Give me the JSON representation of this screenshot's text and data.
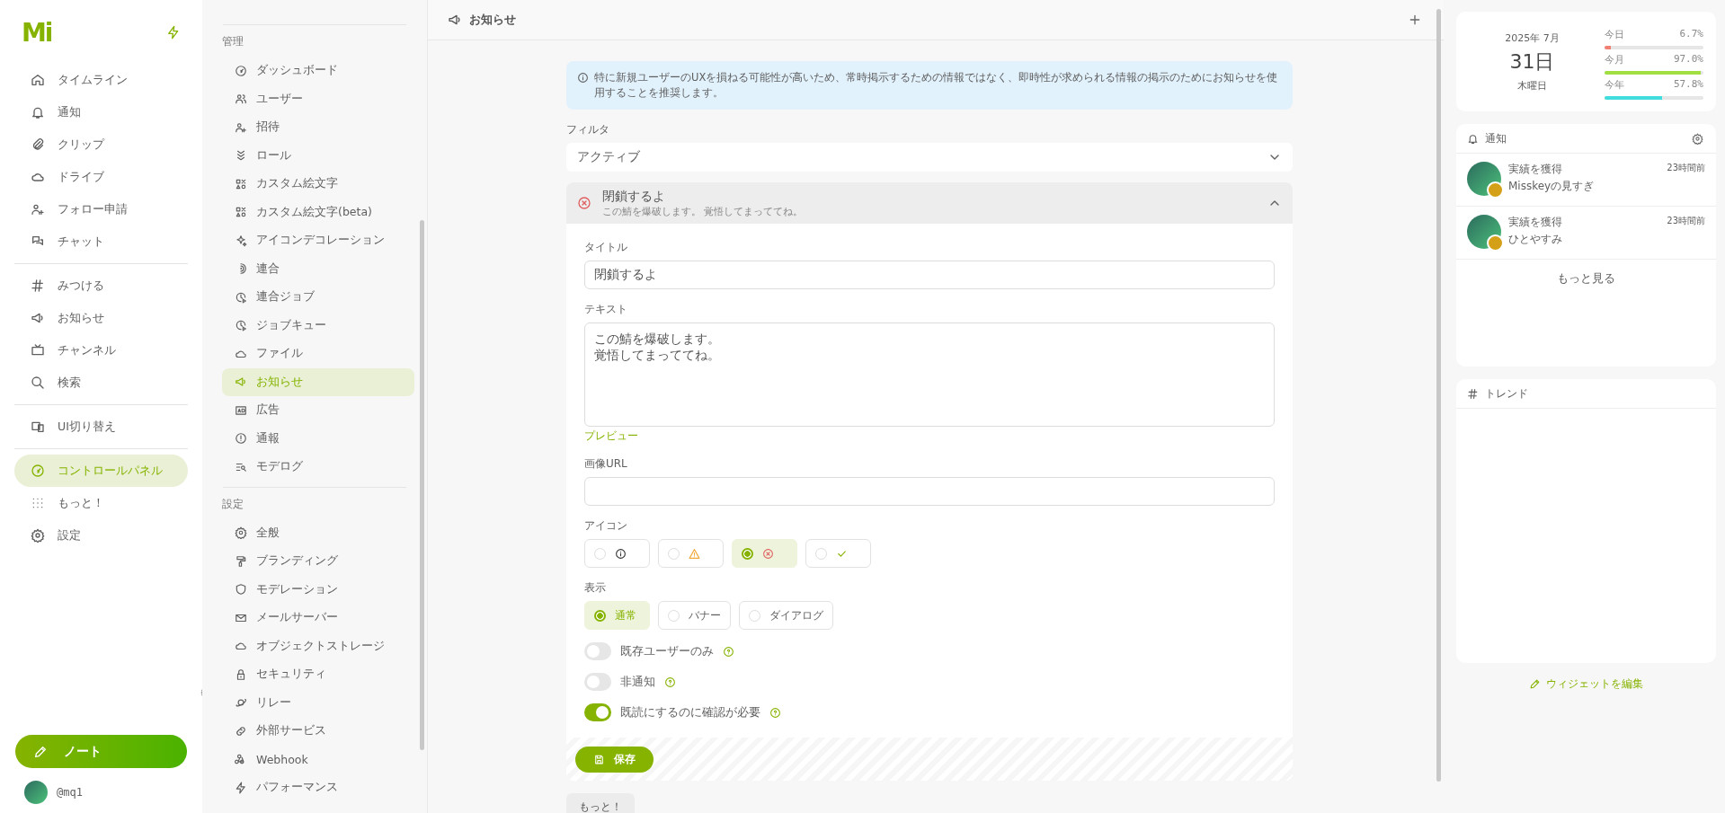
{
  "nav": {
    "logo": "Mi",
    "groups": [
      [
        {
          "label": "タイムライン",
          "selected": false
        },
        {
          "label": "通知",
          "selected": false
        },
        {
          "label": "クリップ",
          "selected": false
        },
        {
          "label": "ドライブ",
          "selected": false
        },
        {
          "label": "フォロー申請",
          "selected": false
        },
        {
          "label": "チャット",
          "selected": false
        }
      ],
      [
        {
          "label": "みつける",
          "selected": false
        },
        {
          "label": "お知らせ",
          "selected": false
        },
        {
          "label": "チャンネル",
          "selected": false
        },
        {
          "label": "検索",
          "selected": false
        }
      ],
      [
        {
          "label": "UI切り替え",
          "selected": false
        }
      ],
      [
        {
          "label": "コントロールパネル",
          "selected": true
        },
        {
          "label": "もっと！",
          "selected": false
        },
        {
          "label": "設定",
          "selected": false
        }
      ]
    ],
    "note_button": "ノート",
    "account": "@mq1"
  },
  "admin_menu": {
    "sections": [
      {
        "title": "管理",
        "items": [
          {
            "label": "ダッシュボード",
            "selected": false
          },
          {
            "label": "ユーザー",
            "selected": false
          },
          {
            "label": "招待",
            "selected": false
          },
          {
            "label": "ロール",
            "selected": false
          },
          {
            "label": "カスタム絵文字",
            "selected": false
          },
          {
            "label": "カスタム絵文字(beta)",
            "selected": false
          },
          {
            "label": "アイコンデコレーション",
            "selected": false
          },
          {
            "label": "連合",
            "selected": false
          },
          {
            "label": "連合ジョブ",
            "selected": false
          },
          {
            "label": "ジョブキュー",
            "selected": false
          },
          {
            "label": "ファイル",
            "selected": false
          },
          {
            "label": "お知らせ",
            "selected": true
          },
          {
            "label": "広告",
            "selected": false
          },
          {
            "label": "通報",
            "selected": false
          },
          {
            "label": "モデログ",
            "selected": false
          }
        ]
      },
      {
        "title": "設定",
        "items": [
          {
            "label": "全般",
            "selected": false
          },
          {
            "label": "ブランディング",
            "selected": false
          },
          {
            "label": "モデレーション",
            "selected": false
          },
          {
            "label": "メールサーバー",
            "selected": false
          },
          {
            "label": "オブジェクトストレージ",
            "selected": false
          },
          {
            "label": "セキュリティ",
            "selected": false
          },
          {
            "label": "リレー",
            "selected": false
          },
          {
            "label": "外部サービス",
            "selected": false
          },
          {
            "label": "Webhook",
            "selected": false
          },
          {
            "label": "パフォーマンス",
            "selected": false
          }
        ]
      }
    ]
  },
  "header": {
    "title": "お知らせ"
  },
  "notice": "特に新規ユーザーのUXを損ねる可能性が高いため、常時掲示するための情報ではなく、即時性が求められる情報の掲示のためにお知らせを使用することを推奨します。",
  "filter": {
    "label": "フィルタ",
    "value": "アクティブ"
  },
  "announcement": {
    "title": "閉鎖するよ",
    "summary": "この鯖を爆破します。 覚悟してまっててね。",
    "expanded": true,
    "title_label": "タイトル",
    "title_value": "閉鎖するよ",
    "text_label": "テキスト",
    "text_lines": [
      "この鯖を爆破します。",
      "覚悟してまっててね。"
    ],
    "preview_link": "プレビュー",
    "image_url_label": "画像URL",
    "icon_label": "アイコン",
    "icon_options": [
      {
        "selected": false
      },
      {
        "selected": false
      },
      {
        "selected": true
      },
      {
        "selected": false
      }
    ],
    "display_label": "表示",
    "display_options": [
      {
        "label": "通常",
        "selected": true
      },
      {
        "label": "バナー",
        "selected": false
      },
      {
        "label": "ダイアログ",
        "selected": false
      }
    ],
    "toggles": [
      {
        "label": "既存ユーザーのみ",
        "on": false
      },
      {
        "label": "非通知",
        "on": false
      },
      {
        "label": "既読にするのに確認が必要",
        "on": true
      }
    ],
    "save_button": "保存"
  },
  "more_button": "もっと！",
  "right": {
    "calendar": {
      "year_month": "2025年 7月",
      "day": "31日",
      "weekday": "木曜日",
      "bars": [
        {
          "label": "今日",
          "reading": "6.7%",
          "level": 0.067,
          "color": "#f28072"
        },
        {
          "label": "今月",
          "reading": "97.0%",
          "level": 0.97,
          "color": "#a1de41"
        },
        {
          "label": "今年",
          "reading": "57.8%",
          "level": 0.578,
          "color": "#41ddde"
        }
      ]
    },
    "notifications": {
      "title": "通知",
      "items": [
        {
          "title": "実績を獲得",
          "body": "Misskeyの見すぎ",
          "time": "23時間前"
        },
        {
          "title": "実績を獲得",
          "body": "ひとやすみ",
          "time": "23時間前"
        }
      ],
      "more": "もっと見る"
    },
    "trends": {
      "title": "トレンド"
    },
    "edit_widgets": "ウィジェットを編集"
  }
}
